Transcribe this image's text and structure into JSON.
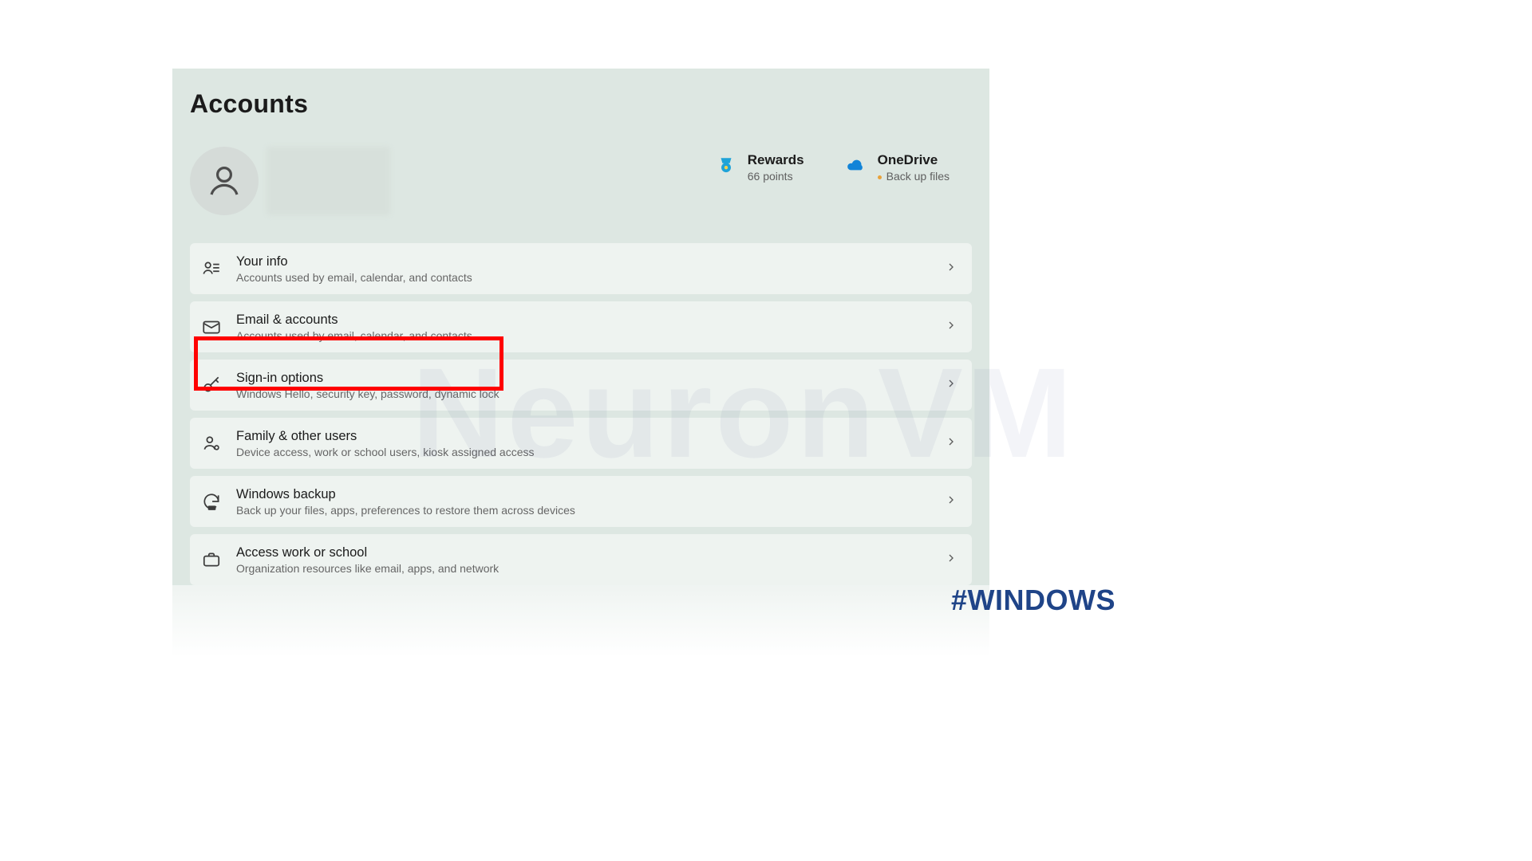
{
  "page_title": "Accounts",
  "cards": {
    "rewards": {
      "title": "Rewards",
      "sub": "66 points"
    },
    "onedrive": {
      "title": "OneDrive",
      "sub": "Back up files"
    }
  },
  "rows": [
    {
      "icon": "your-info-icon",
      "title": "Your info",
      "sub": "Accounts used by email, calendar, and contacts"
    },
    {
      "icon": "email-icon",
      "title": "Email & accounts",
      "sub": "Accounts used by email, calendar, and contacts"
    },
    {
      "icon": "key-icon",
      "title": "Sign-in options",
      "sub": "Windows Hello, security key, password, dynamic lock"
    },
    {
      "icon": "family-icon",
      "title": "Family & other users",
      "sub": "Device access, work or school users, kiosk assigned access"
    },
    {
      "icon": "backup-icon",
      "title": "Windows backup",
      "sub": "Back up your files, apps, preferences to restore them across devices"
    },
    {
      "icon": "briefcase-icon",
      "title": "Access work or school",
      "sub": "Organization resources like email, apps, and network"
    }
  ],
  "watermark": "NeuronVM",
  "hashtag": "#WINDOWS"
}
